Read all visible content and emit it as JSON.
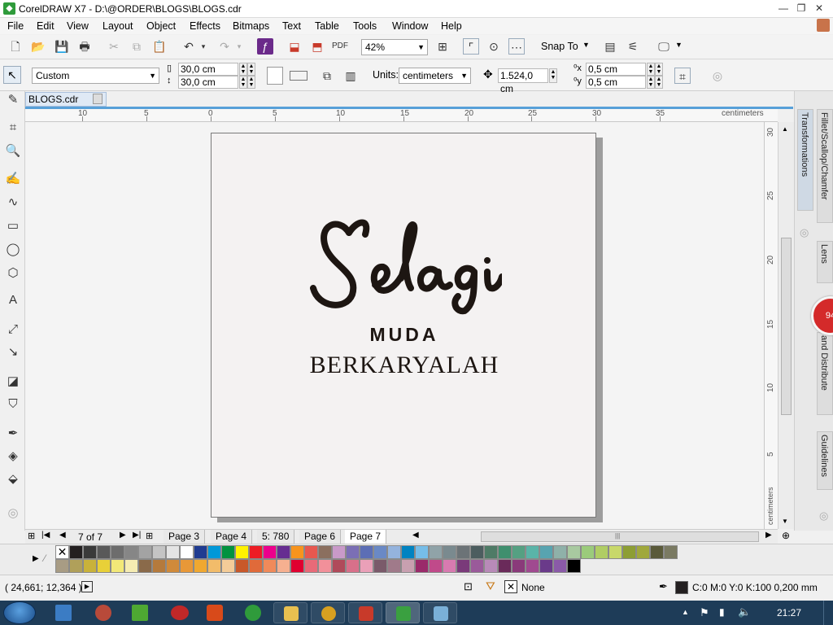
{
  "window": {
    "title": "CorelDRAW X7 - D:\\@ORDER\\BLOGS\\BLOGS.cdr",
    "app_icon": "coreldraw-icon",
    "minimize": "—",
    "maximize": "❐",
    "close": "✕"
  },
  "menu": [
    "File",
    "Edit",
    "View",
    "Layout",
    "Object",
    "Effects",
    "Bitmaps",
    "Text",
    "Table",
    "Tools",
    "Window",
    "Help"
  ],
  "std_toolbar": {
    "zoom": "42%",
    "snap_to": "Snap To"
  },
  "property_bar": {
    "page_preset": "Custom",
    "width": "30,0 cm",
    "height": "30,0 cm",
    "units_label": "Units:",
    "units": "centimeters",
    "nudge": "1.524,0 cm",
    "dup_x": "0,5 cm",
    "dup_y": "0,5 cm"
  },
  "document_tab": "BLOGS.cdr",
  "ruler": {
    "units": "centimeters",
    "h_labels": [
      "10",
      "5",
      "0",
      "5",
      "10",
      "15",
      "20",
      "25",
      "30",
      "35"
    ],
    "v_labels": [
      "30",
      "25",
      "20",
      "15",
      "10",
      "5"
    ]
  },
  "artwork": {
    "script": "Selagi",
    "line2": "MUDA",
    "line3": "BERKARYALAH"
  },
  "dockers": {
    "transformations": "Transformations",
    "fillet": "Fillet/Scallop/Chamfer",
    "lens": "Lens",
    "align": "and Distribute",
    "guidelines": "Guidelines"
  },
  "badge": "94",
  "page_nav": {
    "counter": "7 of 7",
    "tabs": [
      "Page 3",
      "Page 4",
      "5: 780",
      "Page 6",
      "Page 7"
    ],
    "active": "Page 7"
  },
  "palette": {
    "row1": [
      "#231f20",
      "#3a3a3a",
      "#595959",
      "#6d6d6d",
      "#868686",
      "#a3a3a3",
      "#c4c4c4",
      "#e4e4e4",
      "#ffffff",
      "#1f3b91",
      "#0098d8",
      "#00923f",
      "#fff200",
      "#ed1c24",
      "#ec008c",
      "#662d91",
      "#f7941d",
      "#e7584f",
      "#8b6f5f",
      "#c99ac9",
      "#7b6fb5",
      "#5c6eb5",
      "#6a89c5",
      "#94b3dd",
      "#0083c1",
      "#76bde8",
      "#90a3a8",
      "#7a8a8f",
      "#6c7377",
      "#4c5d5f",
      "#4e7b66",
      "#3f8f6e",
      "#55a082",
      "#5ab4a8",
      "#58a4b0",
      "#8fb1a9",
      "#a8c9a0",
      "#9bcb7b",
      "#b0cd64",
      "#c8d86a",
      "#8d9e34",
      "#a0a83c",
      "#5a5a3a",
      "#7a7a62"
    ],
    "row2": [
      "#a89c84",
      "#b0a05a",
      "#c9b23a",
      "#e8d038",
      "#f2e878",
      "#f5ecb2",
      "#8a6a4a",
      "#b57a3c",
      "#d08a3a",
      "#e89838",
      "#f0a830",
      "#f2bc6a",
      "#f4cc98",
      "#c8582a",
      "#e06a3a",
      "#f08a5a",
      "#f6b090",
      "#e00030",
      "#e86a78",
      "#f2909a",
      "#b04a5a",
      "#d8708a",
      "#eaa0b8",
      "#7a5a6a",
      "#a07a8a",
      "#c8a0b0",
      "#9a2a6a",
      "#c04a8a",
      "#d87ab0",
      "#7a3a7a",
      "#9a5a9a",
      "#b88ab8",
      "#6a2a5a",
      "#8a3a7a",
      "#a04a90",
      "#6a3a8a",
      "#8a5aa8",
      "#000000"
    ]
  },
  "status": {
    "coords": "( 24,661; 12,364 )",
    "fill": "None",
    "outline": "C:0 M:0 Y:0 K:100  0,200 mm"
  },
  "taskbar": {
    "time": "21:27"
  }
}
